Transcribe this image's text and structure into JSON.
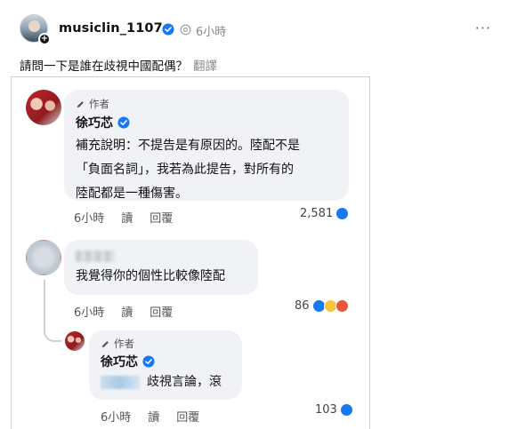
{
  "post": {
    "username": "musiclin_1107",
    "time": "6小時",
    "more_label": "···",
    "caption": "請問一下是誰在歧視中國配偶？",
    "translate_label": "翻譯"
  },
  "comments": [
    {
      "author_tag": "作者",
      "name": "徐巧芯",
      "lines": [
        "補充說明：不提告是有原因的。陸配不是",
        "「負面名詞」，我若為此提告，對所有的",
        "陸配都是一種傷害。"
      ],
      "time": "6小時",
      "read_label": "讀",
      "reply_label": "回覆",
      "count": "2,581"
    },
    {
      "text": "我覺得你的個性比較像陸配",
      "time": "6小時",
      "read_label": "讀",
      "reply_label": "回覆",
      "count": "86"
    },
    {
      "author_tag": "作者",
      "name": "徐巧芯",
      "text": "歧視言論，滾",
      "time": "6小時",
      "read_label": "讀",
      "reply_label": "回覆",
      "count": "103"
    }
  ],
  "colors": {
    "like": "#1877f2",
    "haha": "#f7c43f",
    "angry": "#e6573a",
    "verified": "#1877f2"
  },
  "icons": [
    "verified-badge-icon",
    "threads-globe-icon",
    "pencil-icon",
    "like-reaction-icon",
    "haha-reaction-icon",
    "angry-reaction-icon"
  ]
}
